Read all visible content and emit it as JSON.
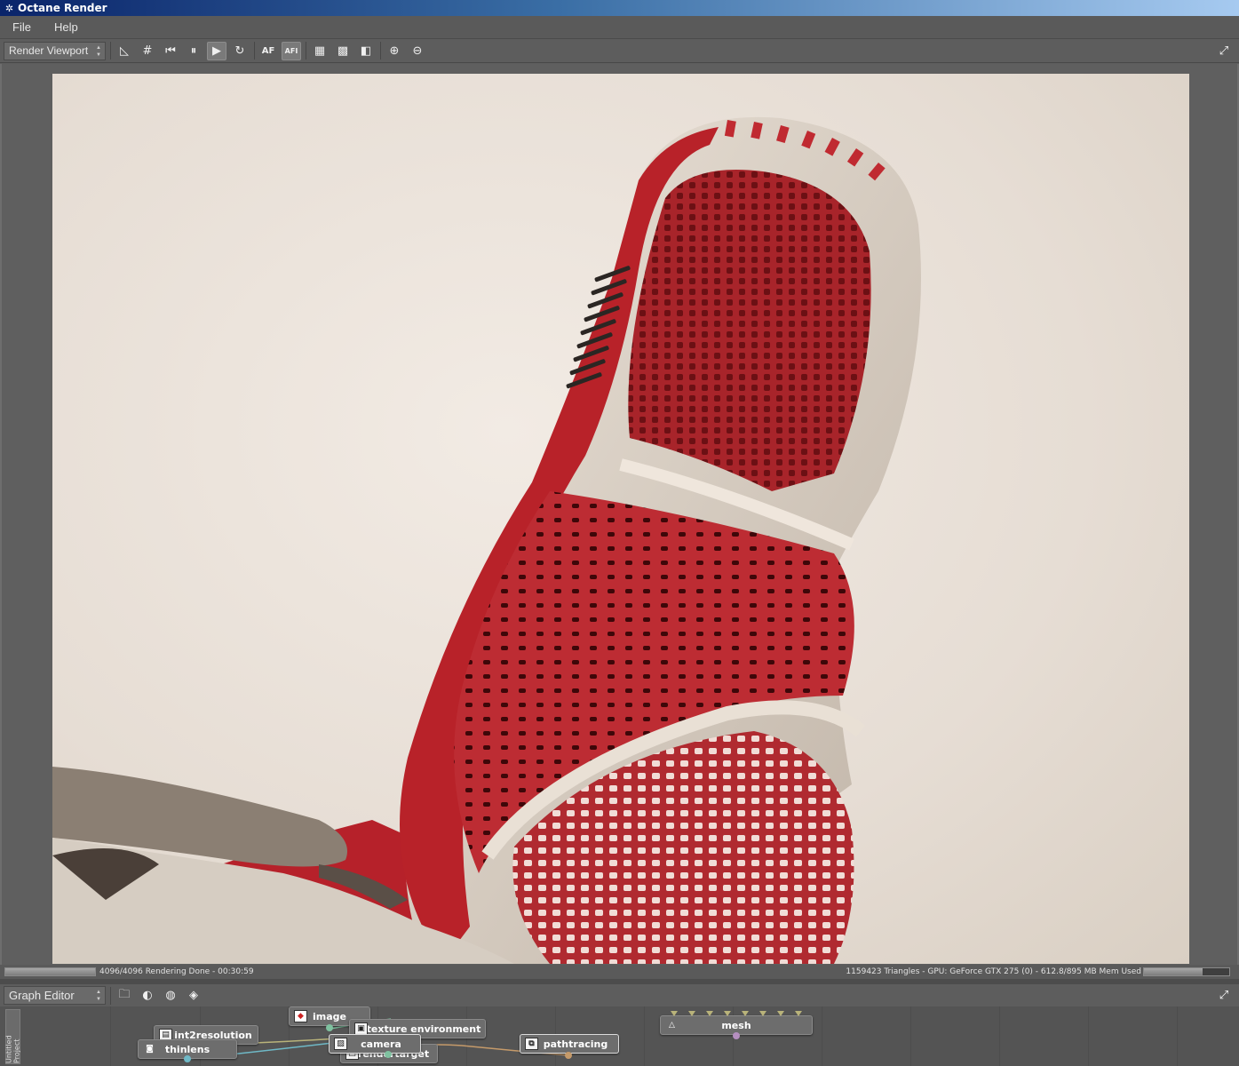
{
  "window": {
    "title": "Octane Render"
  },
  "menu": {
    "items": [
      "File",
      "Help"
    ]
  },
  "viewport_toolbar": {
    "mode_select": "Render Viewport",
    "buttons": [
      {
        "name": "ruler-icon",
        "glyph": "◺"
      },
      {
        "name": "region-grid-icon",
        "glyph": "#"
      },
      {
        "name": "restart-icon",
        "glyph": "⏮"
      },
      {
        "name": "pause-icon",
        "glyph": "⏸"
      },
      {
        "name": "play-icon",
        "glyph": "▶"
      },
      {
        "name": "refresh-icon",
        "glyph": "↻"
      },
      {
        "name": "autofocus-icon",
        "glyph": "AF"
      },
      {
        "name": "autofocus-pick-icon",
        "glyph": "AFI"
      },
      {
        "name": "alpha-icon",
        "glyph": "▦"
      },
      {
        "name": "checker-icon",
        "glyph": "▩"
      },
      {
        "name": "clay-icon",
        "glyph": "◧"
      },
      {
        "name": "zoom-in-icon",
        "glyph": "⊕"
      },
      {
        "name": "zoom-out-icon",
        "glyph": "⊖"
      }
    ]
  },
  "status": {
    "progress": 1.0,
    "left_text": "4096/4096 Rendering Done - 00:30:59",
    "right_text": "1159423 Triangles - GPU: GeForce GTX 275 (0) - 612.8/895 MB Mem Used",
    "mem_fraction": 0.685
  },
  "graph_editor": {
    "mode_select": "Graph Editor",
    "side_tab": "Untitled Project",
    "nodes": [
      {
        "id": "image",
        "label": "image",
        "icon": "image-icon"
      },
      {
        "id": "int2resolution",
        "label": "int2resolution",
        "icon": "resolution-icon"
      },
      {
        "id": "texture-environment",
        "label": "texture environment",
        "icon": "environment-icon"
      },
      {
        "id": "thinlens",
        "label": "thinlens",
        "icon": "camera-icon"
      },
      {
        "id": "camera",
        "label": "camera",
        "icon": "picture-icon"
      },
      {
        "id": "render-target",
        "label": "rendertarget",
        "icon": "target-icon"
      },
      {
        "id": "pathtracing",
        "label": "pathtracing",
        "icon": "kernel-icon"
      },
      {
        "id": "mesh",
        "label": "mesh",
        "icon": "mesh-icon"
      }
    ]
  },
  "colors": {
    "accent_red": "#b5232a",
    "chair_shell": "#d8cfc4",
    "background": "#ece4dc"
  }
}
